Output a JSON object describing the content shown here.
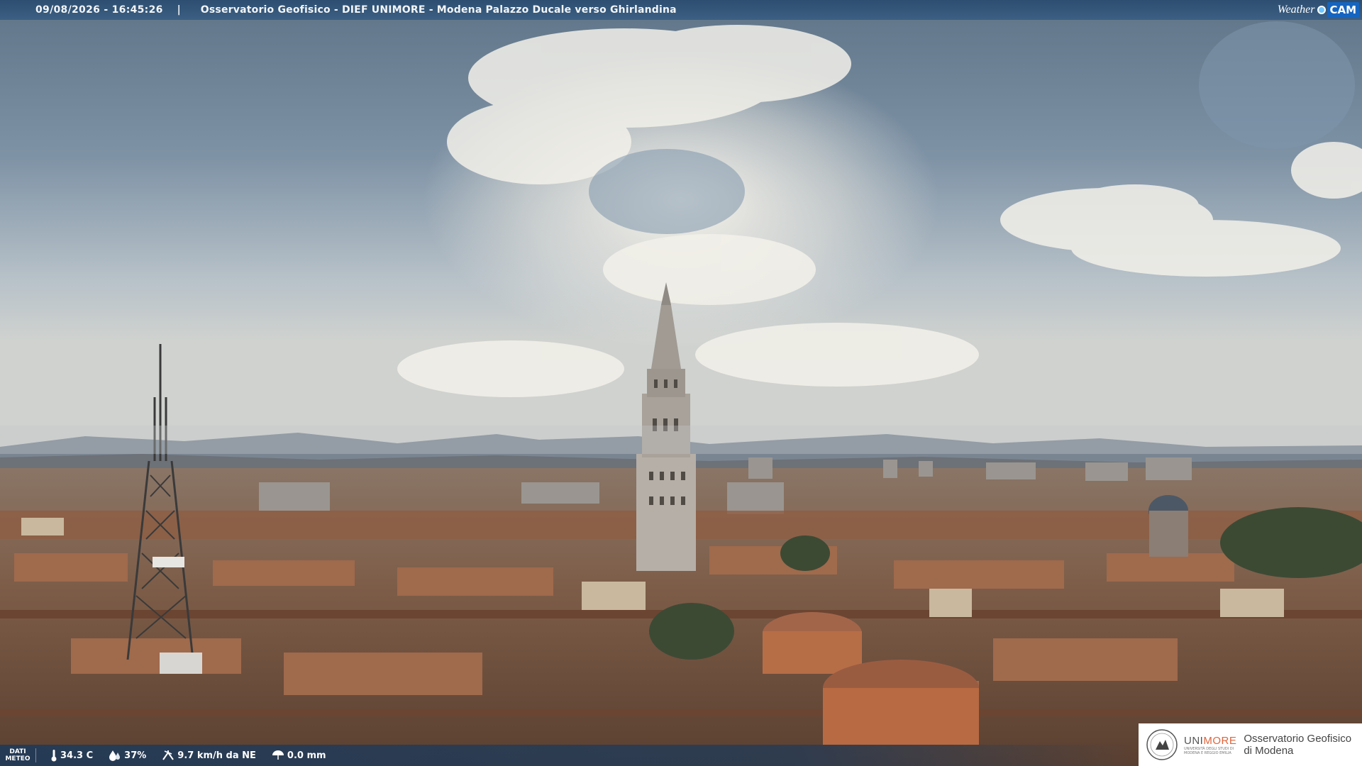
{
  "overlay": {
    "timestamp": "09/08/2026 - 16:45:26",
    "separator": "|",
    "camera_title": "Osservatorio Geofisico - DIEF UNIMORE - Modena Palazzo Ducale verso Ghirlandina",
    "brand_left": "Weather",
    "brand_right": "CAM"
  },
  "weather": {
    "label_line1": "DATI",
    "label_line2": "METEO",
    "temperature": "34.3 C",
    "humidity": "37%",
    "wind": "9.7 km/h da NE",
    "rain": "0.0 mm"
  },
  "logo": {
    "uni_name_a": "UNI",
    "uni_name_b": "MORE",
    "uni_sub1": "UNIVERSITÀ DEGLI STUDI DI",
    "uni_sub2": "MODENA E REGGIO EMILIA",
    "obs_line1": "Osservatorio Geofisico",
    "obs_line2": "di Modena"
  },
  "colors": {
    "bar": "#2d4e71",
    "accent_orange": "#e0643a",
    "brand_blue": "#1565c0"
  }
}
